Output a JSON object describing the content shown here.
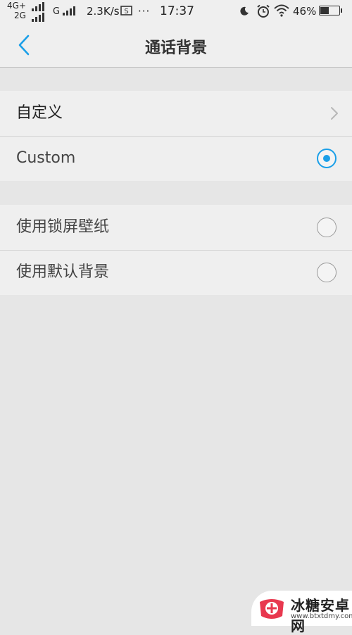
{
  "status_bar": {
    "network_top": "4G+",
    "network_bottom": "2G",
    "network_g": "G",
    "speed": "2.3K/s",
    "more": "···",
    "time": "17:37",
    "battery": "46%"
  },
  "header": {
    "title": "通话背景"
  },
  "group_custom": {
    "items": [
      {
        "label": "自定义",
        "type": "chevron"
      },
      {
        "label": "Custom",
        "type": "radio",
        "selected": true
      }
    ]
  },
  "group_options": {
    "items": [
      {
        "label": "使用锁屏壁纸",
        "type": "radio",
        "selected": false
      },
      {
        "label": "使用默认背景",
        "type": "radio",
        "selected": false
      }
    ]
  },
  "watermark": {
    "title": "冰糖安卓网",
    "url": "www.btxtdmy.com"
  },
  "colors": {
    "accent": "#1a9fe8",
    "background": "#e6e6e6",
    "row_background": "#efefef"
  },
  "icons": {
    "back": "chevron-left-icon",
    "row_arrow": "chevron-right-icon",
    "radio_selected": "radio-checked-icon",
    "radio_unselected": "radio-unchecked-icon"
  }
}
